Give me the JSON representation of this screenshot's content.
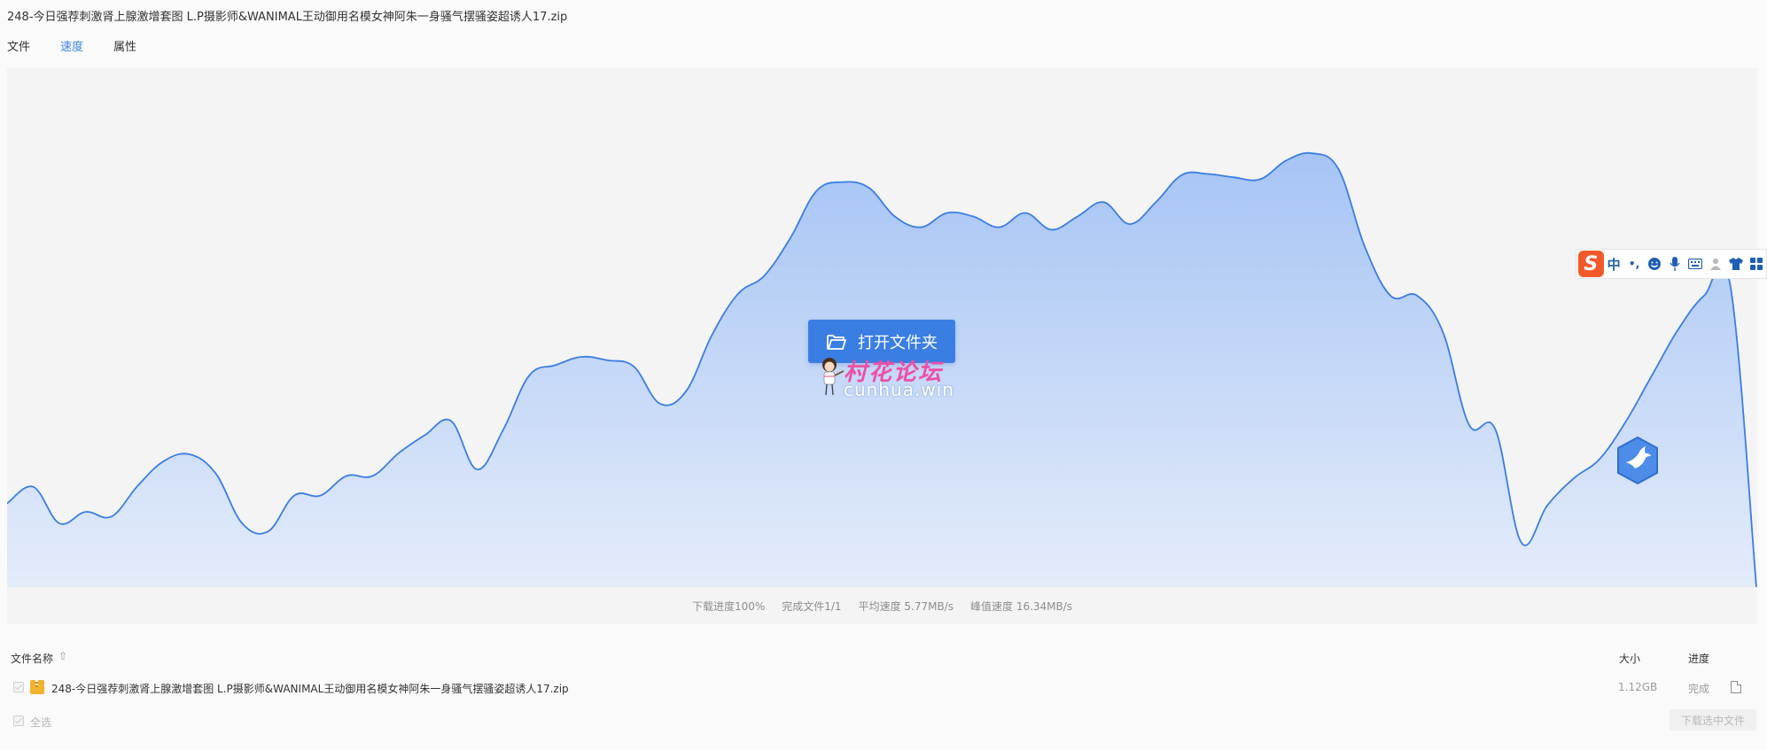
{
  "window": {
    "title": "248-今日强荐刺激肾上腺激增套图 L.P摄影师&WANIMAL王动御用名模女神阿朱一身骚气摆骚姿超诱人17.zip"
  },
  "tabs": [
    {
      "label": "文件",
      "active": false
    },
    {
      "label": "速度",
      "active": true
    },
    {
      "label": "属性",
      "active": false
    }
  ],
  "chart_data": {
    "type": "area",
    "title": "",
    "xlabel": "",
    "ylabel": "",
    "grid": false,
    "ylim": [
      0,
      16.34
    ],
    "color": "#3a7ee4",
    "fill_top": "#a6c4f5",
    "fill_bottom": "#e4ecfa",
    "series": [
      {
        "values": [
          2.7,
          3.24,
          2.06,
          2.43,
          2.28,
          3.27,
          4.07,
          4.29,
          3.66,
          2.06,
          1.8,
          2.96,
          2.96,
          3.59,
          3.59,
          4.33,
          4.91,
          5.37,
          3.8,
          5.08,
          6.84,
          7.17,
          7.44,
          7.33,
          7.13,
          5.93,
          6.32,
          8.15,
          9.48,
          10.06,
          11.28,
          12.8,
          13.09,
          12.91,
          11.98,
          11.63,
          12.09,
          11.98,
          11.63,
          12.09,
          11.55,
          11.98,
          12.44,
          11.73,
          12.44,
          13.32,
          13.35,
          13.24,
          13.18,
          13.79,
          14.02,
          13.5,
          11.0,
          9.41,
          9.42,
          8.23,
          5.24,
          5.1,
          1.44,
          2.65,
          3.51,
          4.14,
          5.35,
          6.84,
          8.32,
          9.42,
          9.76,
          0.0
        ]
      }
    ],
    "stats": {
      "progress": "下载进度100%",
      "files_done": "完成文件1/1",
      "avg_speed": "平均速度 5.77MB/s",
      "peak_speed": "峰值速度 16.34MB/s"
    }
  },
  "actions": {
    "open_folder_label": "打开文件夹"
  },
  "watermark": {
    "cn_text": "村花论坛",
    "en_text": "cunhua.win"
  },
  "ime": {
    "logo": "S",
    "mode": "中",
    "punct": "•,",
    "icons": [
      "emoji-icon",
      "microphone-icon",
      "keyboard-icon",
      "user-icon",
      "skin-icon",
      "toolbox-icon"
    ]
  },
  "file_list": {
    "header": {
      "name_label": "文件名称",
      "sort_glyph": "⇧",
      "size_label": "大小",
      "progress_label": "进度"
    },
    "files": [
      {
        "name": "248-今日强荐刺激肾上腺激增套图 L.P摄影师&WANIMAL王动御用名模女神阿朱一身骚气摆骚姿超诱人17.zip",
        "size": "1.12GB",
        "status": "完成"
      }
    ],
    "select_all_label": "全选",
    "download_selected_label": "下载选中文件"
  }
}
